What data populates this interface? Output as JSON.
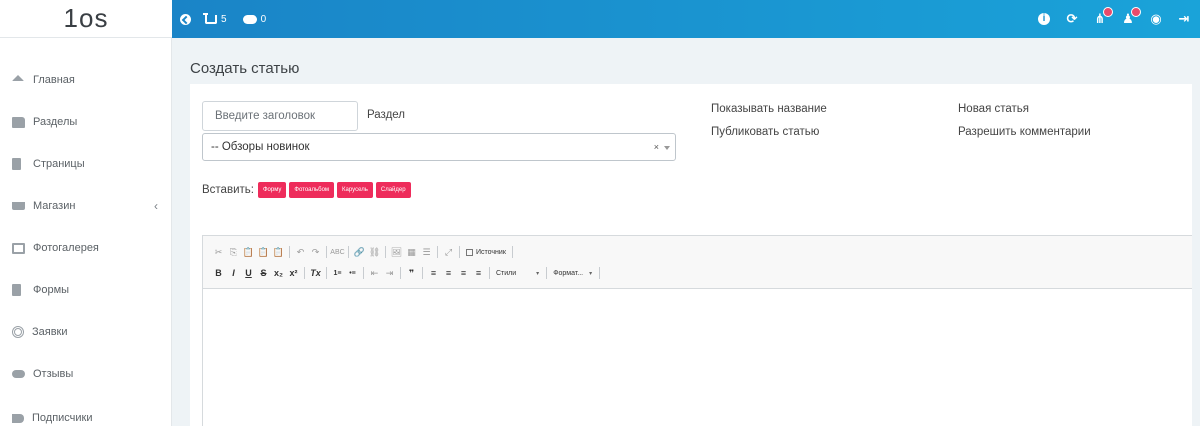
{
  "brand": {
    "logo_text": "1os"
  },
  "topbar": {
    "cart_count": "5",
    "messages_count": "0",
    "icons": [
      "back-icon",
      "cart-icon",
      "chat-icon",
      "info-icon",
      "refresh-icon",
      "sitemap-icon",
      "users-icon",
      "eye-icon",
      "logout-icon"
    ]
  },
  "sidebar": {
    "items": [
      {
        "label": "Главная",
        "icon": "home-icon"
      },
      {
        "label": "Разделы",
        "icon": "folder-icon"
      },
      {
        "label": "Страницы",
        "icon": "page-icon"
      },
      {
        "label": "Магазин",
        "icon": "cart-icon",
        "chevron": "‹"
      },
      {
        "label": "Фотогалерея",
        "icon": "image-icon"
      },
      {
        "label": "Формы",
        "icon": "file-icon"
      },
      {
        "label": "Заявки",
        "icon": "target-icon"
      },
      {
        "label": "Отзывы",
        "icon": "comments-icon"
      },
      {
        "label": "Подписчики",
        "icon": "megaphone-icon"
      }
    ]
  },
  "page": {
    "title": "Создать статью",
    "title_input": {
      "value": "",
      "placeholder": "Введите заголовок"
    },
    "section_label": "Раздел",
    "section_select": {
      "value": "-- Обзоры новинок",
      "clear": "×"
    },
    "options": {
      "show_title": "Показывать название",
      "publish": "Публиковать статью",
      "new_article": "Новая статья",
      "allow_comments": "Разрешить комментарии"
    },
    "insert": {
      "label": "Вставить:",
      "buttons": [
        "Форму",
        "Фотоальбом",
        "Карусель",
        "Слайдер"
      ]
    }
  },
  "editor": {
    "source_label": "Источник",
    "styles_label": "Стили",
    "format_label": "Формат...",
    "row1": [
      "✂",
      "⎘",
      "📋",
      "📋",
      "📋",
      "↶",
      "↷",
      "ABC",
      "🔗",
      "⛓",
      "🖼",
      "▦",
      "☰",
      "⤢"
    ],
    "row2": [
      "B",
      "I",
      "U",
      "S",
      "x₂",
      "x²",
      "Tx",
      "1≡",
      "•≡",
      "⇤",
      "⇥",
      "❞",
      "≡",
      "≡",
      "≡",
      "≡"
    ]
  },
  "colors": {
    "topbar_start": "#1a7fc4",
    "topbar_end": "#1aa3d9",
    "insert_button": "#ee2c5b",
    "background": "#eef3f6"
  }
}
